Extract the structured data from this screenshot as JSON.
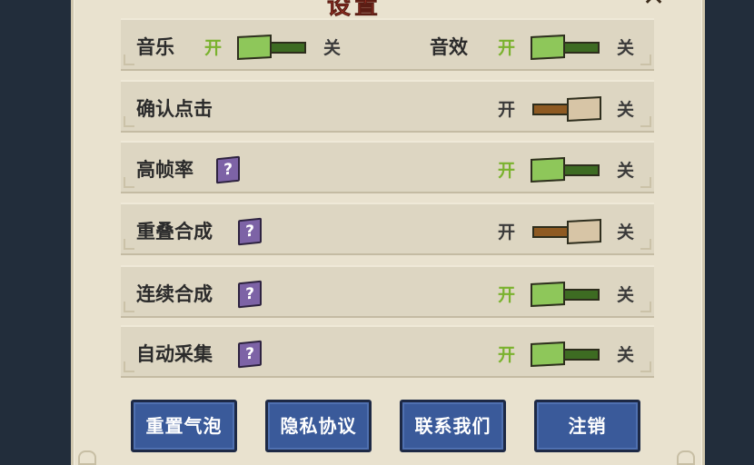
{
  "dialog": {
    "title": "设置",
    "close_label": "✕"
  },
  "toggle_labels": {
    "on": "开",
    "off": "关"
  },
  "settings": {
    "music": {
      "label": "音乐",
      "state": "on"
    },
    "sfx": {
      "label": "音效",
      "state": "on"
    },
    "confirm_click": {
      "label": "确认点击",
      "state": "off"
    },
    "high_fps": {
      "label": "高帧率",
      "state": "on",
      "help": "?"
    },
    "overlap_merge": {
      "label": "重叠合成",
      "state": "off",
      "help": "?"
    },
    "continuous_merge": {
      "label": "连续合成",
      "state": "on",
      "help": "?"
    },
    "auto_collect": {
      "label": "自动采集",
      "state": "on",
      "help": "?"
    }
  },
  "buttons": {
    "reset_bubbles": "重置气泡",
    "privacy": "隐私协议",
    "contact": "联系我们",
    "logout": "注销"
  },
  "colors": {
    "panel_bg": "#e9e2cf",
    "row_bg": "#ddd6c2",
    "on_green": "#8ec75a",
    "off_brown": "#8e5a22",
    "button_blue": "#3a5a9a",
    "help_purple": "#7d63a6",
    "title_red": "#c0392b"
  }
}
